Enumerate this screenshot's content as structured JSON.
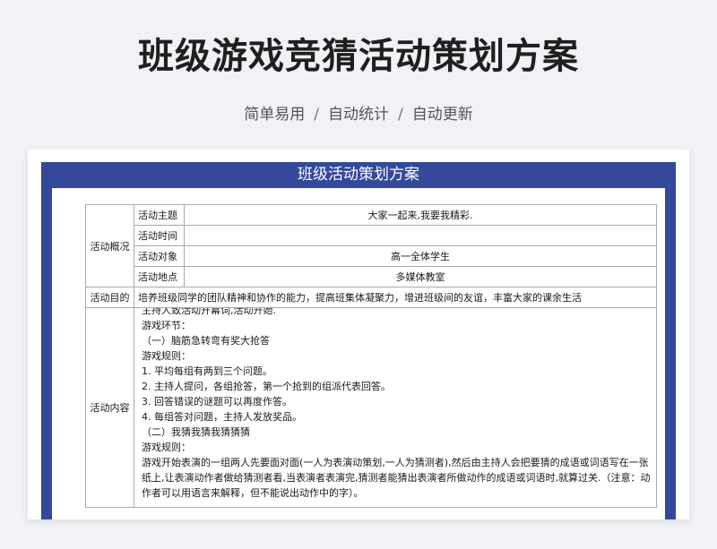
{
  "page": {
    "title": "班级游戏竞猜活动策划方案",
    "subtitle_parts": [
      "简单易用",
      "自动统计",
      "自动更新"
    ],
    "subtitle_separator": "/"
  },
  "doc": {
    "header": "班级活动策划方案",
    "overview_label": "活动概况",
    "overview_rows": [
      {
        "label": "活动主题",
        "value": "大家一起来,我要我精彩."
      },
      {
        "label": "活动时间",
        "value": ""
      },
      {
        "label": "活动对象",
        "value": "高一全体学生"
      },
      {
        "label": "活动地点",
        "value": "多媒体教室"
      }
    ],
    "purpose_label": "活动目的",
    "purpose_value": "培养班级同学的团队精神和协作的能力，提高班集体凝聚力，增进班级间的友谊，丰富大家的课余生活",
    "content_label": "活动内容",
    "content_lines": [
      "主持人致活动开幕词,活动开始.",
      "游戏环节：",
      "（一）脑筋急转弯有奖大抢答",
      "游戏规则：",
      "1. 平均每组有两到三个问题。",
      "2. 主持人提问，各组抢答，第一个抢到的组派代表回答。",
      "3. 回答错误的谜题可以再度作答。",
      "4. 每组答对问题，主持人发放奖品。",
      "（二）我猜我猜我猜猜猜",
      "游戏规则：",
      "游戏开始表演的一组两人先要面对面(一人为表演动策划,一人为猜测者),然后由主持人会把要猜的成语或词语写在一张纸上,让表演动作者做给猜测者看,当表演者表演完,猜测者能猜出表演者所做动作的成语或词语时,就算过关.（注意：动作者可以用语言来解释，但不能说出动作中的字）。"
    ]
  },
  "colors": {
    "frame_blue": "#34499a",
    "background": "#f0f2f5",
    "border": "#a9a9a9"
  }
}
